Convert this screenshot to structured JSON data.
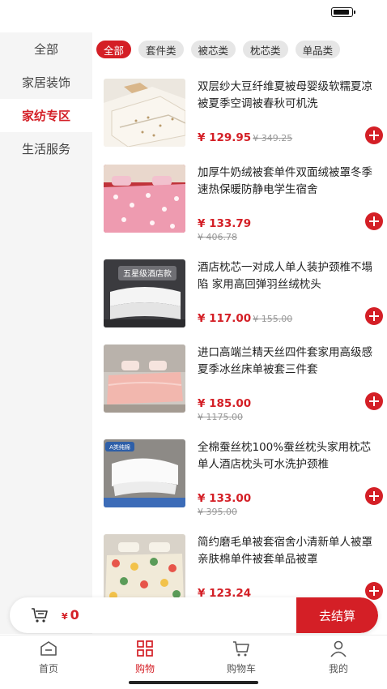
{
  "sidebar": {
    "items": [
      {
        "label": "全部"
      },
      {
        "label": "家居装饰"
      },
      {
        "label": "家纺专区"
      },
      {
        "label": "生活服务"
      }
    ]
  },
  "categories": [
    "全部",
    "套件类",
    "被芯类",
    "枕芯类",
    "单品类"
  ],
  "products": [
    {
      "name": "双层纱大豆纤维夏被母婴级软糯夏凉被夏季空调被春秋可机洗",
      "price": "¥ 129.95",
      "original_price": "¥ 349.25",
      "image_text": ""
    },
    {
      "name": "加厚牛奶绒被套单件双面绒被罩冬季速热保暖防静电学生宿舍",
      "price": "¥ 133.79",
      "original_price": "¥ 406.78",
      "image_text": ""
    },
    {
      "name": "酒店枕芯一对成人单人装护颈椎不塌陷 家用高回弹羽丝绒枕头",
      "price": "¥ 117.00",
      "original_price": "¥ 155.00",
      "image_text": "五星级酒店款"
    },
    {
      "name": "进口高端兰精天丝四件套家用高级感夏季冰丝床单被套三件套",
      "price": "¥ 185.00",
      "original_price": "¥ 1175.00",
      "image_text": ""
    },
    {
      "name": "全棉蚕丝枕100%蚕丝枕头家用枕芯单人酒店枕头可水洗护颈椎",
      "price": "¥ 133.00",
      "original_price": "¥ 395.00",
      "image_text": "A类纯棉"
    },
    {
      "name": "简约磨毛单被套宿舍小清新单人被罩亲肤棉单件被套单品被罩",
      "price": "¥ 123.24",
      "original_price": "",
      "image_text": ""
    }
  ],
  "cart": {
    "total": "0",
    "currency": "¥",
    "checkout_label": "去结算"
  },
  "tabs": [
    {
      "label": "首页",
      "icon": "home-icon"
    },
    {
      "label": "购物",
      "icon": "grid-icon"
    },
    {
      "label": "购物车",
      "icon": "cart-icon"
    },
    {
      "label": "我的",
      "icon": "user-icon"
    }
  ],
  "colors": {
    "accent": "#d41f26",
    "sidebar_bg": "#f5f5f5",
    "chip_bg": "#e6e6e6"
  }
}
